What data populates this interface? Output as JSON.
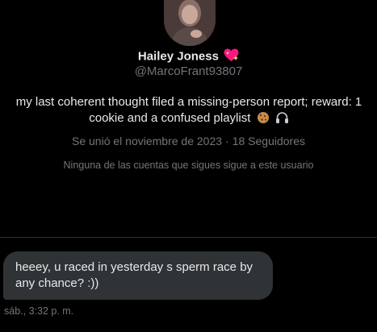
{
  "profile": {
    "display_name": "Hailey Joness",
    "display_name_icon": "sparkling-heart-icon",
    "handle": "@MarcoFrant93807",
    "bio": "my last coherent thought filed a missing-person report; reward: 1 cookie and a confused playlist",
    "bio_icons": [
      "cookie-icon",
      "headphones-icon"
    ],
    "joined": "Se unió el noviembre de 2023",
    "separator": "·",
    "followers": "18 Seguidores",
    "mutual_followers": "Ninguna de las cuentas que sigues sigue a este usuario"
  },
  "conversation": {
    "messages": [
      {
        "text": "heeey, u raced in yesterday s sperm race by any chance? :))",
        "timestamp": "sáb., 3:32 p. m."
      }
    ]
  },
  "colors": {
    "background": "#000000",
    "primary_text": "#e7e9ea",
    "secondary_text": "#71767b",
    "bubble": "#2f3336",
    "divider": "#2f3336",
    "heart": "#f91880"
  }
}
